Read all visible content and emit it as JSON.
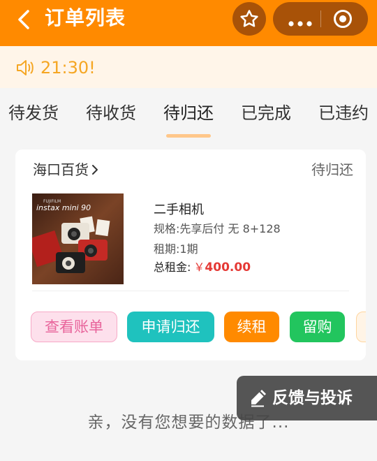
{
  "header": {
    "title": "订单列表",
    "icons": [
      "back-arrow-icon",
      "star-icon",
      "more-dots-icon",
      "close-miniprogram-icon"
    ]
  },
  "notice": {
    "text": "21:30!",
    "icon": "speaker-icon"
  },
  "tabs": [
    {
      "label": "待发货"
    },
    {
      "label": "待收货"
    },
    {
      "label": "待归还",
      "active": true
    },
    {
      "label": "已完成"
    },
    {
      "label": "已违约"
    }
  ],
  "order": {
    "shop_name": "海口百货",
    "status": "待归还",
    "product": {
      "name": "二手相机",
      "spec": "规格:先享后付 无 8+128",
      "term": "租期:1期",
      "total_label": "总租金:",
      "currency": "￥",
      "total_amount": "400.00",
      "image_brand": "FUJIFILM",
      "image_model": "instax mini 90"
    },
    "buttons": {
      "view_bill": "查看账单",
      "apply_return": "申请归还",
      "renew": "续租",
      "buyout": "留购"
    }
  },
  "empty_text": "亲，没有您想要的数据了...",
  "feedback": {
    "label": "反馈与投诉",
    "icon": "edit-pen-icon"
  },
  "colors": {
    "header_bg": "#ff8a00",
    "notice_bg": "#fff5e9",
    "notice_text": "#f5a623",
    "price": "#e53935",
    "return_btn": "#1fc2be",
    "buy_btn": "#22c55e"
  }
}
